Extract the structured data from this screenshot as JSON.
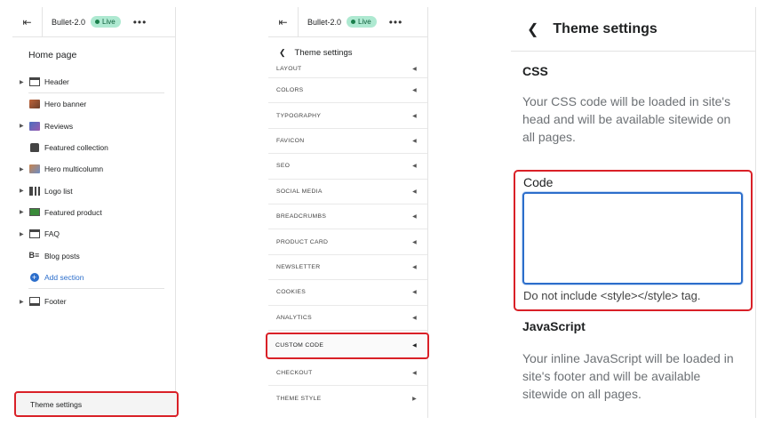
{
  "store": {
    "name": "Bullet-2.0",
    "status": "Live"
  },
  "editor": {
    "page_title": "Home page",
    "sections": [
      {
        "label": "Header",
        "icon": "header-icon",
        "expandable": true
      },
      {
        "label": "Hero banner",
        "icon": "image-icon",
        "expandable": false
      },
      {
        "label": "Reviews",
        "icon": "image-icon",
        "expandable": true
      },
      {
        "label": "Featured collection",
        "icon": "collection-icon",
        "expandable": false
      },
      {
        "label": "Hero multicolumn",
        "icon": "image-icon",
        "expandable": true
      },
      {
        "label": "Logo list",
        "icon": "logo-list-icon",
        "expandable": true
      },
      {
        "label": "Featured product",
        "icon": "product-icon",
        "expandable": true
      },
      {
        "label": "FAQ",
        "icon": "faq-icon",
        "expandable": true
      },
      {
        "label": "Blog posts",
        "icon": "blog-icon",
        "expandable": false
      }
    ],
    "add_section_label": "Add section",
    "footer_label": "Footer",
    "theme_settings_label": "Theme settings"
  },
  "settings_menu": {
    "title": "Theme settings",
    "items": [
      "LAYOUT",
      "COLORS",
      "TYPOGRAPHY",
      "FAVICON",
      "SEO",
      "SOCIAL MEDIA",
      "BREADCRUMBS",
      "PRODUCT CARD",
      "NEWSLETTER",
      "COOKIES",
      "ANALYTICS",
      "CUSTOM CODE",
      "CHECKOUT",
      "THEME STYLE"
    ],
    "highlighted": "CUSTOM CODE"
  },
  "custom_code": {
    "title": "Theme settings",
    "css_heading": "CSS",
    "css_description": "Your CSS code will be loaded in site's head and will be available sitewide on all pages.",
    "code_label": "Code",
    "code_value": "",
    "code_hint": "Do not include <style></style> tag.",
    "js_heading": "JavaScript",
    "js_description": "Your inline JavaScript will be loaded in site's footer and will be available sitewide on all pages."
  },
  "colors": {
    "accent": "#2c6ecb",
    "highlight": "#d92027",
    "live_badge": "#aee9d1"
  }
}
